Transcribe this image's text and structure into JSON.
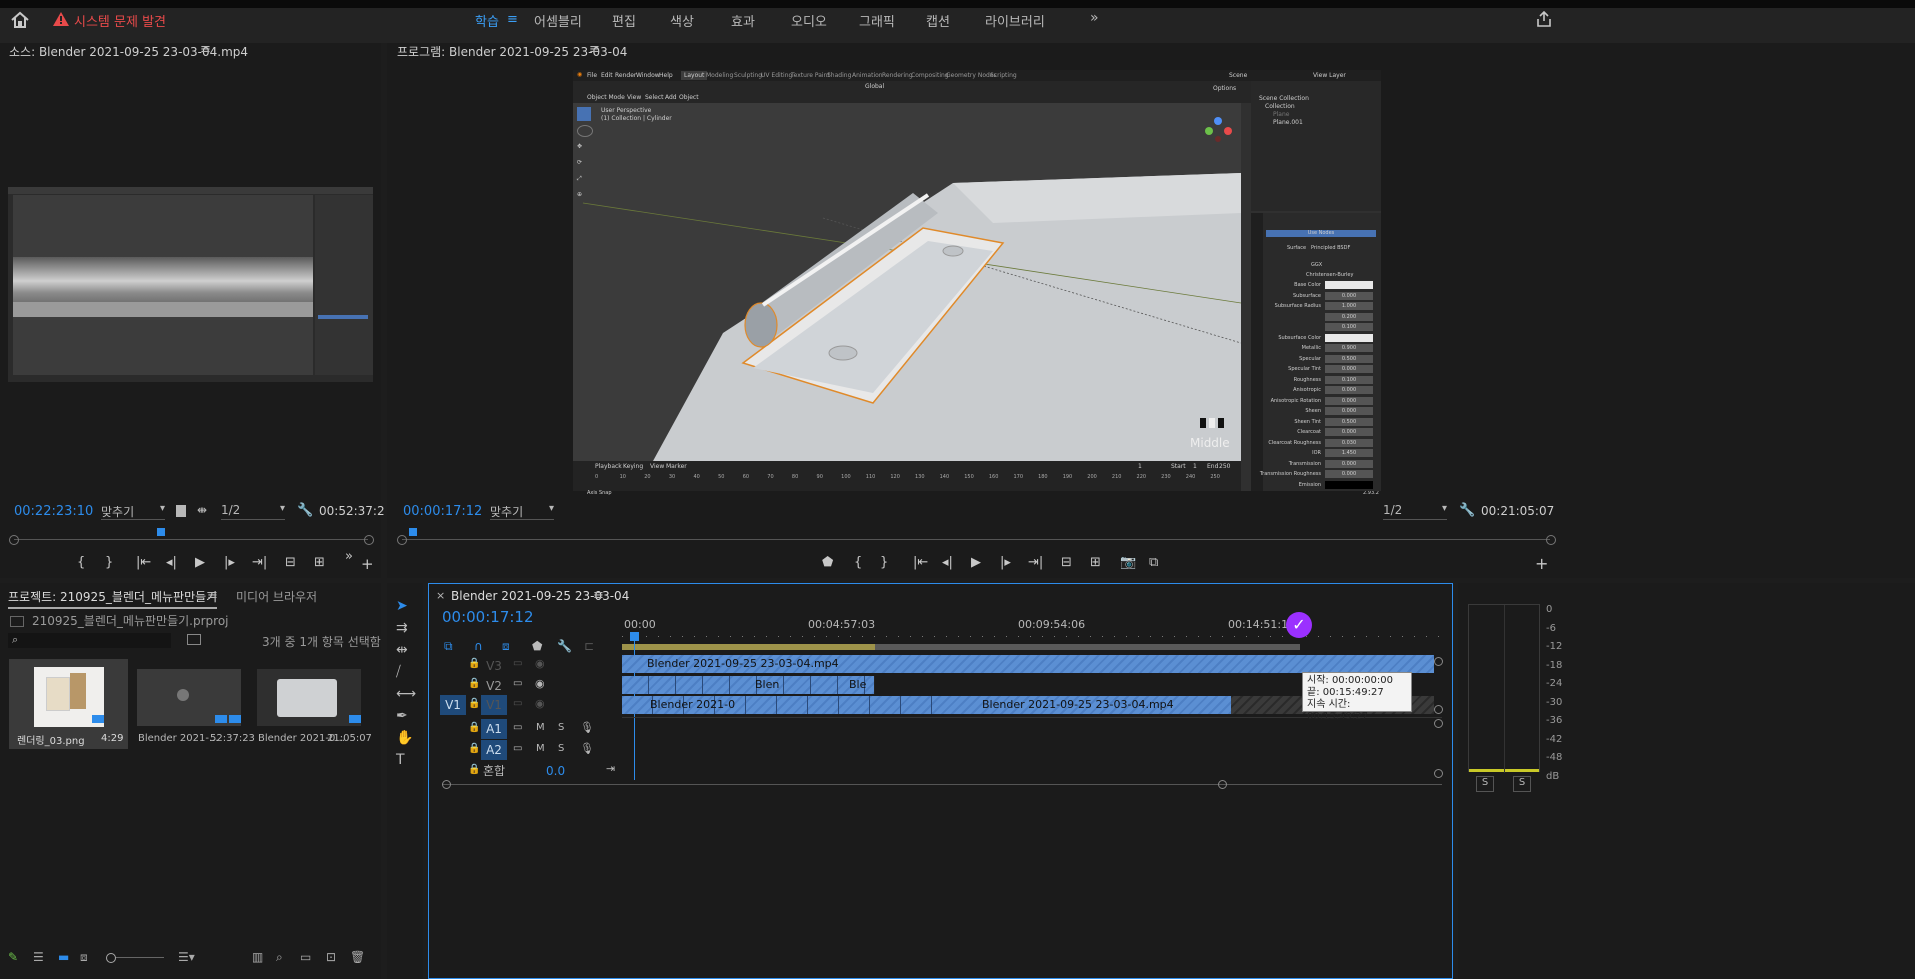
{
  "topbar": {
    "alert": "시스템 문제 발견",
    "workspaces": [
      "학습",
      "어셈블리",
      "편집",
      "색상",
      "효과",
      "오디오",
      "그래픽",
      "캡션",
      "라이브러리"
    ],
    "more": "»"
  },
  "source": {
    "title": "소스: Blender 2021-09-25 23-03-04.mp4",
    "timecode": "00:22:23:10",
    "fit": "맞추기",
    "res": "1/2",
    "duration": "00:52:37:2"
  },
  "program": {
    "title": "프로그램: Blender 2021-09-25 23-03-04",
    "timecode": "00:00:17:12",
    "fit": "맞추기",
    "res": "1/2",
    "duration": "00:21:05:07",
    "blender": {
      "menus": [
        "File",
        "Edit",
        "Render",
        "Window",
        "Help"
      ],
      "tabs": [
        "Layout",
        "Modeling",
        "Sculpting",
        "UV Editing",
        "Texture Paint",
        "Shading",
        "Animation",
        "Rendering",
        "Compositing",
        "Geometry Nodes",
        "Scripting"
      ],
      "scene": "Scene",
      "view_layer": "View Layer",
      "viewport_info1": "User Perspective",
      "viewport_info2": "(1) Collection | Cylinder",
      "mode": "Object Mode",
      "view_menus": [
        "View",
        "Select",
        "Add",
        "Object"
      ],
      "orientation": "Global",
      "options": "Options",
      "outliner": [
        "Scene Collection",
        "Collection",
        "Plane",
        "Plane.001"
      ],
      "middle_label": "Middle",
      "use_nodes": "Use Nodes",
      "surface_label": "Surface",
      "surface_value": "Principled BSDF",
      "ggx": "GGX",
      "christensen": "Christensen-Burley",
      "props": [
        {
          "name": "Base Color",
          "value": ""
        },
        {
          "name": "Subsurface",
          "value": "0.000"
        },
        {
          "name": "Subsurface Radius",
          "value": "1.000"
        },
        {
          "name": "",
          "value": "0.200"
        },
        {
          "name": "",
          "value": "0.100"
        },
        {
          "name": "Subsurface Color",
          "value": ""
        },
        {
          "name": "Metallic",
          "value": "0.900"
        },
        {
          "name": "Specular",
          "value": "0.500"
        },
        {
          "name": "Specular Tint",
          "value": "0.000"
        },
        {
          "name": "Roughness",
          "value": "0.100"
        },
        {
          "name": "Anisotropic",
          "value": "0.000"
        },
        {
          "name": "Anisotropic Rotation",
          "value": "0.000"
        },
        {
          "name": "Sheen",
          "value": "0.000"
        },
        {
          "name": "Sheen Tint",
          "value": "0.500"
        },
        {
          "name": "Clearcoat",
          "value": "0.000"
        },
        {
          "name": "Clearcoat Roughness",
          "value": "0.030"
        },
        {
          "name": "IOR",
          "value": "1.450"
        },
        {
          "name": "Transmission",
          "value": "0.000"
        },
        {
          "name": "Transmission Roughness",
          "value": "0.000"
        },
        {
          "name": "Emission",
          "value": ""
        }
      ],
      "timeline_menus": [
        "Playback",
        "Keying",
        "View",
        "Marker"
      ],
      "frame_current": "1",
      "start_label": "Start",
      "start_value": "1",
      "end_label": "End",
      "end_value": "250",
      "ruler": [
        "0",
        "10",
        "20",
        "30",
        "40",
        "50",
        "60",
        "70",
        "80",
        "90",
        "100",
        "110",
        "120",
        "130",
        "140",
        "150",
        "160",
        "170",
        "180",
        "190",
        "200",
        "210",
        "220",
        "230",
        "240",
        "250"
      ],
      "status": "Axis Snap",
      "version": "2.93.2"
    }
  },
  "project": {
    "tab_project": "프로젝트: 210925_블렌더_메뉴판만들기",
    "tab_media": "미디어 브라우저",
    "file": "210925_블렌더_메뉴판만들기.prproj",
    "selection": "3개 중 1개 항목 선택함",
    "items": [
      {
        "name": "렌더링_03.png",
        "dur": "4:29"
      },
      {
        "name": "Blender 2021-...",
        "dur": "52:37:23"
      },
      {
        "name": "Blender 2021-0...",
        "dur": "21:05:07"
      }
    ]
  },
  "timeline": {
    "tab": "Blender 2021-09-25 23-03-04",
    "timecode": "00:00:17:12",
    "ruler": [
      "00:00",
      "00:04:57:03",
      "00:09:54:06",
      "00:14:51:10"
    ],
    "tracks_video": [
      "V3",
      "V2",
      "V1"
    ],
    "source_patch": "V1",
    "tracks_audio": [
      "A1",
      "A2"
    ],
    "mix_label": "혼합",
    "mix_value": "0.0",
    "clip_v3": "Blender 2021-09-25 23-03-04.mp4",
    "clip_v2a": "Blen",
    "clip_v2b": "Ble",
    "clip_v1a": "Blender 2021-0",
    "clip_v1b": "Blender 2021-09-25 23-03-04.mp4",
    "tooltip": {
      "start": "시작: 00:00:00:00",
      "end": "끝: 00:15:49:27",
      "duration": "지속 시간: 00:15:49:27"
    }
  },
  "meter": {
    "scale": [
      "0",
      "-6",
      "-12",
      "-18",
      "-24",
      "-30",
      "-36",
      "-42",
      "-48",
      "dB"
    ],
    "solo": [
      "S",
      "S"
    ]
  },
  "colors": {
    "accent": "#2d8ceb",
    "alert": "#e84a4a",
    "clip": "#5b8fd3",
    "marker": "#9b30ff"
  }
}
